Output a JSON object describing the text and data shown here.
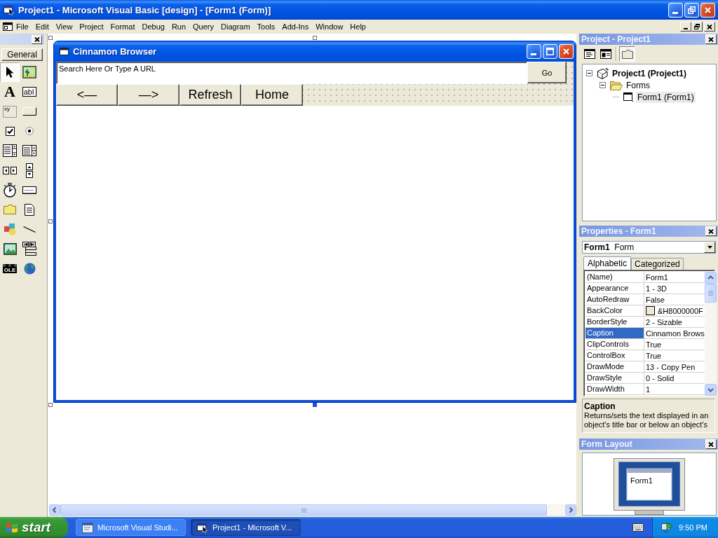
{
  "window": {
    "title": "Project1 - Microsoft Visual Basic [design] - [Form1 (Form)]"
  },
  "menu_bar": [
    {
      "label": "File"
    },
    {
      "label": "Edit"
    },
    {
      "label": "View"
    },
    {
      "label": "Project"
    },
    {
      "label": "Format"
    },
    {
      "label": "Debug"
    },
    {
      "label": "Run"
    },
    {
      "label": "Query"
    },
    {
      "label": "Diagram"
    },
    {
      "label": "Tools"
    },
    {
      "label": "Add-Ins"
    },
    {
      "label": "Window"
    },
    {
      "label": "Help"
    }
  ],
  "toolbox": {
    "tab": "General",
    "tools": [
      {
        "kind": "pointer",
        "selected": true
      },
      {
        "kind": "picture",
        "selected": false
      },
      {
        "kind": "label",
        "glyph": "A",
        "selected": false
      },
      {
        "kind": "textbox",
        "glyph": "abl",
        "selected": false
      },
      {
        "kind": "frame",
        "glyph": "xy",
        "selected": false
      },
      {
        "kind": "command_button",
        "selected": false
      },
      {
        "kind": "checkbox",
        "selected": false
      },
      {
        "kind": "option_button",
        "selected": false
      },
      {
        "kind": "combo_box",
        "selected": false
      },
      {
        "kind": "list_box",
        "selected": false
      },
      {
        "kind": "hscroll",
        "selected": false
      },
      {
        "kind": "vscroll",
        "selected": false
      },
      {
        "kind": "timer",
        "selected": false
      },
      {
        "kind": "drive_list",
        "selected": false
      },
      {
        "kind": "dir_list",
        "selected": false
      },
      {
        "kind": "file_list",
        "selected": false
      },
      {
        "kind": "shape",
        "selected": false
      },
      {
        "kind": "line",
        "selected": false
      },
      {
        "kind": "image",
        "selected": false
      },
      {
        "kind": "data",
        "selected": false
      },
      {
        "kind": "ole",
        "glyph": "OLE",
        "selected": false
      },
      {
        "kind": "web_browser",
        "selected": false
      }
    ]
  },
  "designer": {
    "form": {
      "title": "Cinnamon Browser",
      "selected": true,
      "address_field": {
        "value": "Search Here Or Type A URL"
      },
      "go_button": "Go",
      "nav_buttons": [
        "<—",
        "—>",
        "Refresh",
        "Home"
      ]
    }
  },
  "project": {
    "title": "Project - Project1",
    "toolbar": [
      {
        "kind": "view_code",
        "pressed": false
      },
      {
        "kind": "view_object",
        "pressed": false
      },
      {
        "kind": "toggle_folders",
        "pressed": true
      }
    ],
    "tree": [
      {
        "kind": "project",
        "label": "Project1 (Project1)",
        "expanded": true,
        "selected": false,
        "children": [
          {
            "kind": "folder",
            "label": "Forms",
            "expanded": true,
            "selected": false,
            "children": [
              {
                "kind": "form",
                "label": "Form1 (Form1)",
                "selected": true
              }
            ]
          }
        ]
      }
    ]
  },
  "properties": {
    "title": "Properties - Form1",
    "object": {
      "name": "Form1",
      "type": "Form"
    },
    "tabs": [
      {
        "label": "Alphabetic",
        "selected": true
      },
      {
        "label": "Categorized",
        "selected": false
      }
    ],
    "rows": [
      {
        "kind": "text",
        "name": "(Name)",
        "value": "Form1",
        "selected": false
      },
      {
        "kind": "text",
        "name": "Appearance",
        "value": "1 - 3D",
        "selected": false
      },
      {
        "kind": "text",
        "name": "AutoRedraw",
        "value": "False",
        "selected": false
      },
      {
        "kind": "color",
        "name": "BackColor",
        "value": "&H8000000F",
        "color": "#ece9d8",
        "selected": false
      },
      {
        "kind": "text",
        "name": "BorderStyle",
        "value": "2 - Sizable",
        "selected": false
      },
      {
        "kind": "text",
        "name": "Caption",
        "value": "Cinnamon Brows",
        "selected": true
      },
      {
        "kind": "text",
        "name": "ClipControls",
        "value": "True",
        "selected": false
      },
      {
        "kind": "text",
        "name": "ControlBox",
        "value": "True",
        "selected": false
      },
      {
        "kind": "text",
        "name": "DrawMode",
        "value": "13 - Copy Pen",
        "selected": false
      },
      {
        "kind": "text",
        "name": "DrawStyle",
        "value": "0 - Solid",
        "selected": false
      },
      {
        "kind": "text",
        "name": "DrawWidth",
        "value": "1",
        "selected": false
      }
    ],
    "description": {
      "title": "Caption",
      "text": "Returns/sets the text displayed in an object's title bar or below an object's"
    }
  },
  "form_layout": {
    "title": "Form Layout",
    "form_label": "Form1"
  },
  "taskbar": {
    "start": "start",
    "tasks": [
      {
        "kind": "studio",
        "label": "Microsoft Visual Studi...",
        "selected": false
      },
      {
        "kind": "vb",
        "label": "Project1 - Microsoft V...",
        "selected": true
      }
    ],
    "clock": "9:50 PM"
  }
}
